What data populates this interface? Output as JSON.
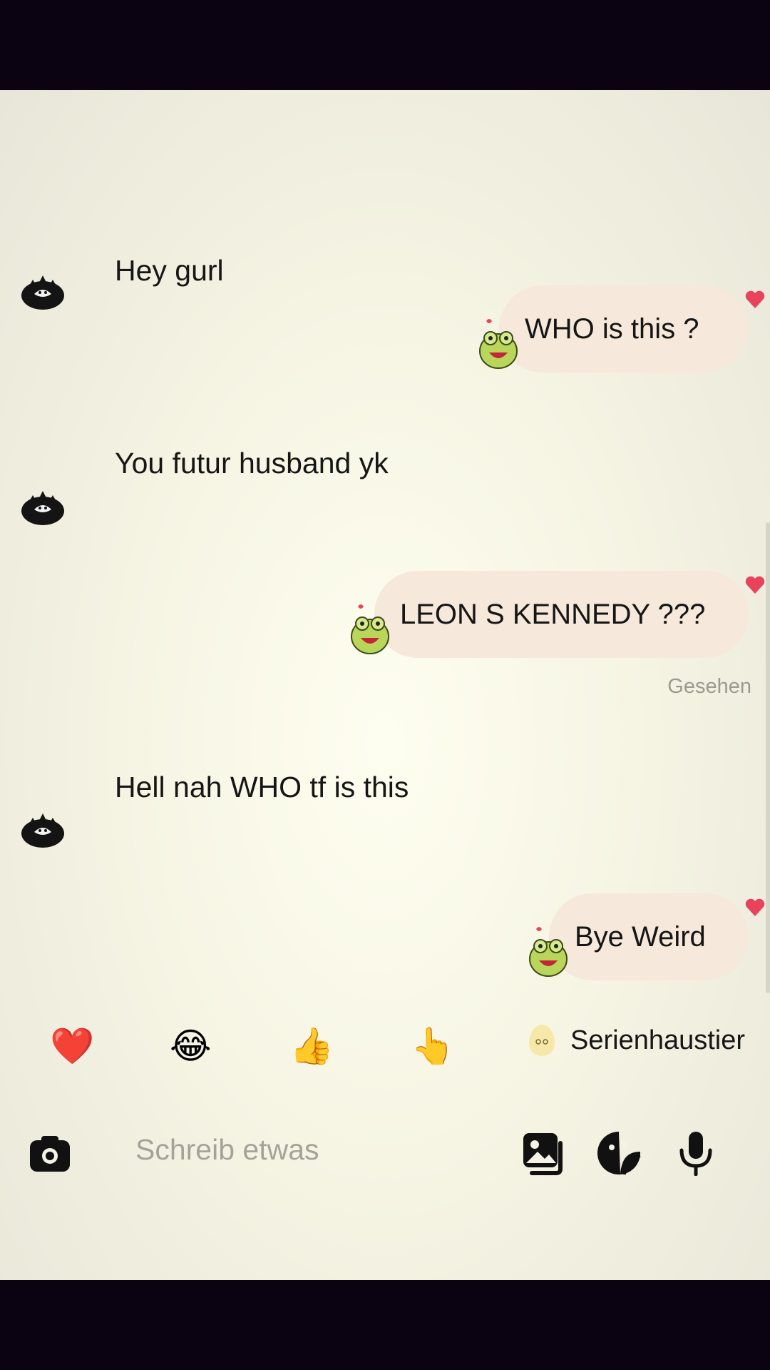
{
  "messages": [
    {
      "direction": "incoming",
      "text": "Hey gurl"
    },
    {
      "direction": "outgoing",
      "text": "WHO is this ?"
    },
    {
      "direction": "incoming",
      "text": "You futur husband yk"
    },
    {
      "direction": "outgoing",
      "text": "LEON S KENNEDY ???"
    },
    {
      "direction": "incoming",
      "text": "Hell nah WHO tf is this"
    },
    {
      "direction": "outgoing",
      "text": "Bye Weird"
    }
  ],
  "seen_label": "Gesehen",
  "quick_reactions": [
    {
      "icon": "heart-icon",
      "glyph": "❤️"
    },
    {
      "icon": "laughing-face-icon",
      "glyph": "😂"
    },
    {
      "icon": "thumbs-up-icon",
      "glyph": "👍"
    },
    {
      "icon": "pointing-hand-icon",
      "glyph": "👆"
    }
  ],
  "pet": {
    "label": "Serienhaustier",
    "icon": "pet-egg-icon"
  },
  "composer": {
    "placeholder": "Schreib etwas",
    "icons": [
      "camera-icon",
      "gallery-icon",
      "sticker-icon",
      "microphone-icon"
    ]
  },
  "colors": {
    "bubble_outgoing": "#f6e8da",
    "reaction_heart": "#e8435a",
    "bars": "#0b0212"
  }
}
